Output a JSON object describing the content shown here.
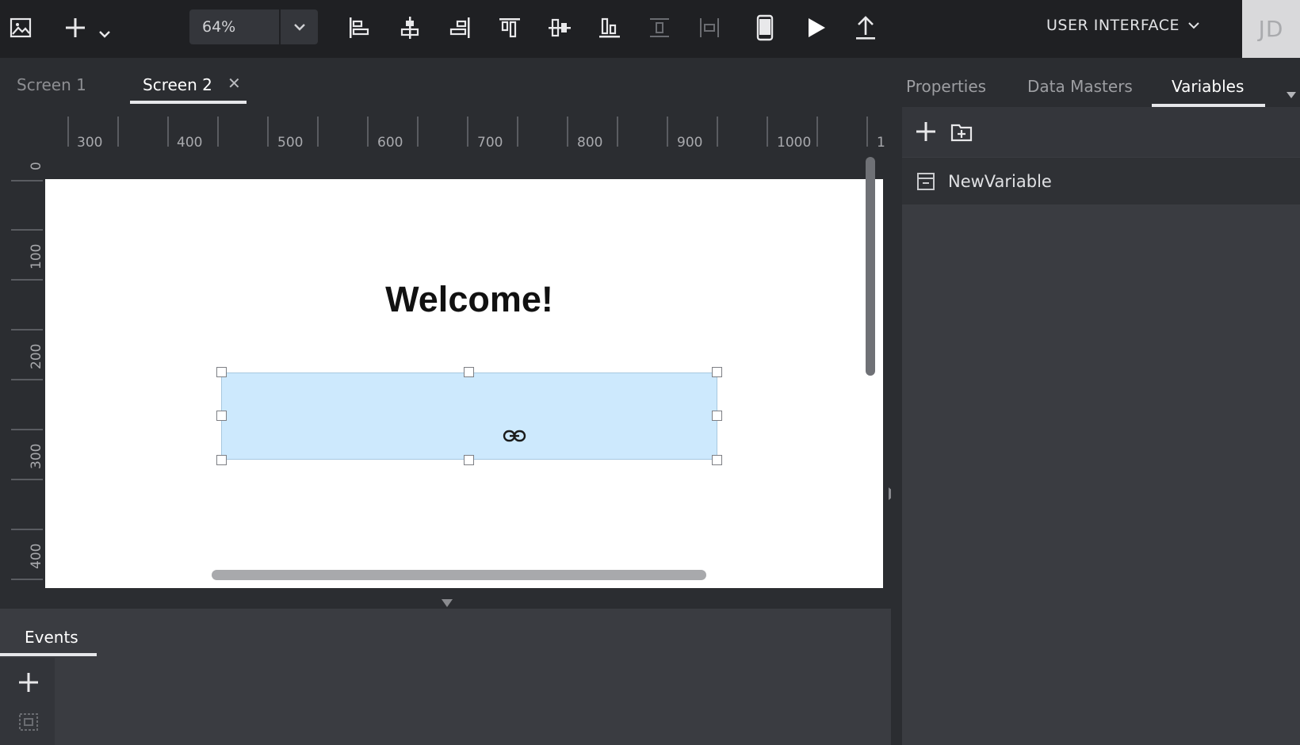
{
  "toolbar": {
    "zoom_value": "64%",
    "mode_label": "USER INTERFACE",
    "avatar_initials": "JD",
    "icons": [
      "image-icon",
      "add-icon",
      "chevron-down-icon",
      "align-left-icon",
      "align-center-icon",
      "align-right-icon",
      "align-top-icon",
      "align-middle-icon",
      "align-bottom-icon",
      "distribute-vertical-icon",
      "distribute-horizontal-icon",
      "device-icon",
      "play-icon",
      "share-icon"
    ]
  },
  "tabs": {
    "screen1": "Screen 1",
    "screen2": "Screen 2",
    "close_glyph": "✕"
  },
  "ruler": {
    "top": [
      "300",
      "400",
      "500",
      "600",
      "700",
      "800",
      "900",
      "1000",
      "1"
    ],
    "left": [
      "0",
      "100",
      "200",
      "300",
      "400"
    ]
  },
  "canvas": {
    "welcome_text": "Welcome!"
  },
  "events": {
    "tab_label": "Events"
  },
  "right_panel": {
    "tabs": {
      "properties": "Properties",
      "data_masters": "Data Masters",
      "variables": "Variables"
    },
    "variables": [
      {
        "name": "NewVariable"
      }
    ]
  },
  "colors": {
    "selection_fill": "#cde9fd",
    "topbar": "#1f2023",
    "panel": "#3a3c41"
  }
}
